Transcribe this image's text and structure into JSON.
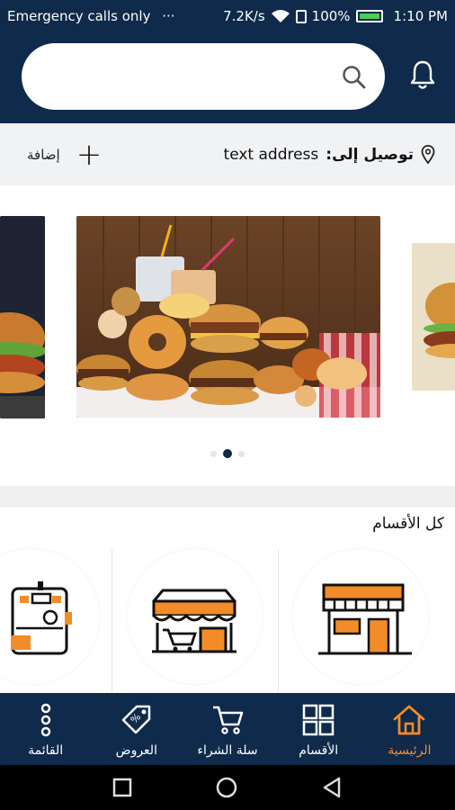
{
  "status_bar": {
    "carrier": "Emergency calls only",
    "more": "···",
    "speed": "7.2K/s",
    "battery": "100%",
    "time": "1:10 PM"
  },
  "search": {
    "placeholder": ""
  },
  "address": {
    "label": "توصيل إلى:",
    "value": "text address",
    "add_label": "إضافة"
  },
  "carousel": {
    "slides": 3,
    "active_index": 1
  },
  "categories": {
    "title": "كل الأقسام",
    "items": [
      "store",
      "market-cart",
      "machine"
    ]
  },
  "bottom_nav": {
    "items": [
      {
        "label": "القائمة",
        "icon": "dots-vertical-icon"
      },
      {
        "label": "العروض",
        "icon": "tag-icon"
      },
      {
        "label": "سلة الشراء",
        "icon": "cart-icon"
      },
      {
        "label": "الأقسام",
        "icon": "grid-icon"
      },
      {
        "label": "الرئيسية",
        "icon": "home-icon"
      }
    ],
    "active": "الرئيسية"
  },
  "colors": {
    "primary": "#0f2a4a",
    "accent": "#f28c28"
  }
}
